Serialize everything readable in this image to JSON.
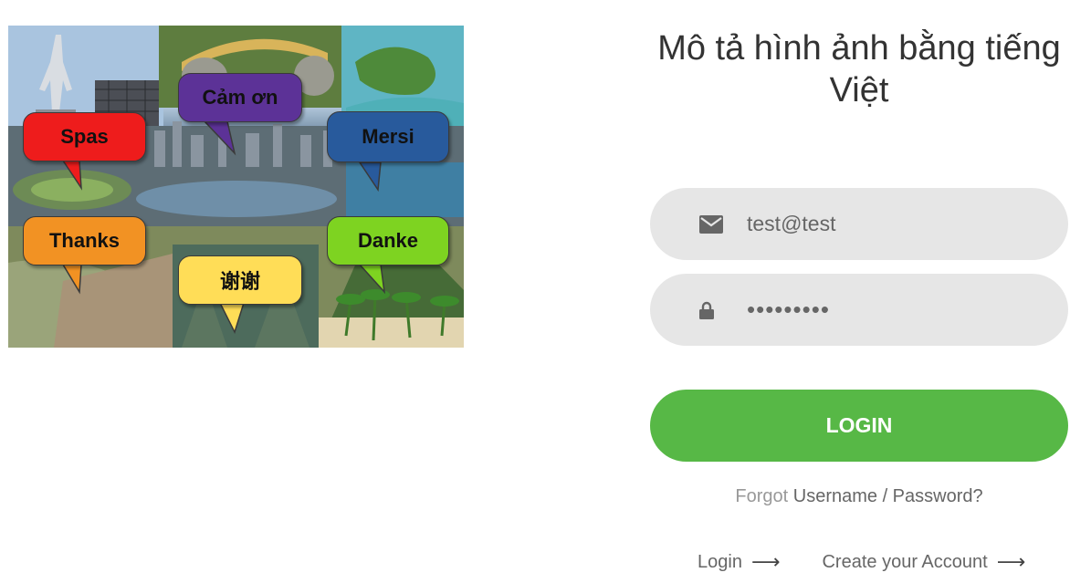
{
  "collage": {
    "bubbles": [
      {
        "text": "Spas",
        "color": "#ee1c1c"
      },
      {
        "text": "Cảm ơn",
        "color": "#5c3297"
      },
      {
        "text": "Mersi",
        "color": "#285a9c"
      },
      {
        "text": "Thanks",
        "color": "#f29223"
      },
      {
        "text": "谢谢",
        "color": "#ffdd57"
      },
      {
        "text": "Danke",
        "color": "#7ed321"
      }
    ]
  },
  "form": {
    "title": "Mô tả hình ảnh bằng tiếng Việt",
    "email": {
      "value": "test@test",
      "icon": "envelope-icon"
    },
    "password": {
      "value": "•••••••••",
      "icon": "lock-icon"
    },
    "login_label": "LOGIN",
    "forgot_prefix": "Forgot",
    "forgot_link": "Username / Password?",
    "links": {
      "login_label": "Login",
      "create_label": "Create your Account",
      "arrow": "⟶"
    }
  },
  "colors": {
    "primary_button": "#57b846",
    "field_bg": "#e6e6e6"
  }
}
